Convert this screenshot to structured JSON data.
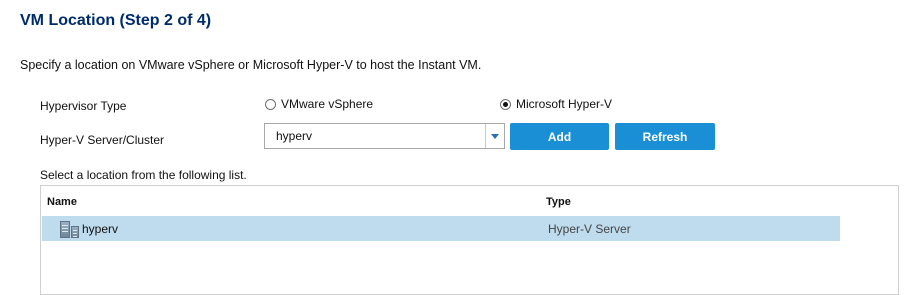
{
  "page": {
    "title": "VM Location (Step 2 of 4)",
    "instruction": "Specify a location on VMware vSphere or Microsoft Hyper-V to host the Instant VM."
  },
  "form": {
    "hypervisor_type_label": "Hypervisor Type",
    "options": [
      {
        "label": "VMware vSphere",
        "checked": false
      },
      {
        "label": "Microsoft Hyper-V",
        "checked": true
      }
    ],
    "server_label": "Hyper-V Server/Cluster",
    "server_value": "hyperv",
    "add_label": "Add",
    "refresh_label": "Refresh"
  },
  "list": {
    "label": "Select a location from the following list.",
    "columns": [
      "Name",
      "Type"
    ],
    "rows": [
      {
        "name": "hyperv",
        "type": "Hyper-V Server",
        "icon": "server-icon",
        "selected": true
      }
    ]
  },
  "colors": {
    "title": "#002b6b",
    "button": "#1b8fd6",
    "selected_row": "#bfdcee"
  }
}
